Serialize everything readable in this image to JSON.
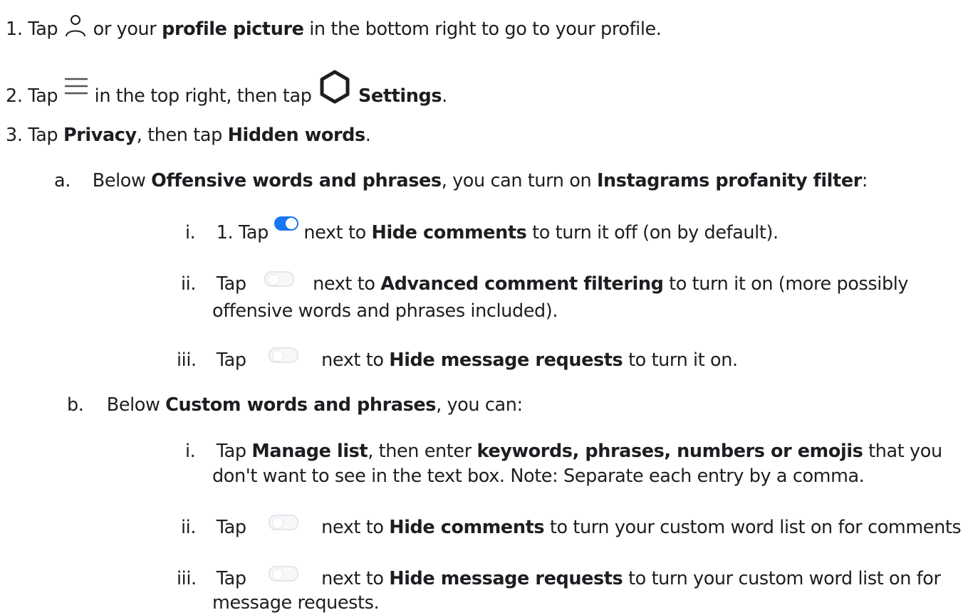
{
  "step1": {
    "prefix": "1. Tap",
    "mid": "or your",
    "bold": "profile picture",
    "suffix": "in the bottom right to go to your profile."
  },
  "step2": {
    "prefix": "2. Tap",
    "mid": "in the top right, then tap",
    "bold": "Settings",
    "suffix": "."
  },
  "step3": {
    "prefix": "3. Tap",
    "bold1": "Privacy",
    "mid": ", then tap",
    "bold2": "Hidden words",
    "suffix": "."
  },
  "a": {
    "marker": "a.",
    "prefix": "Below",
    "bold1": "Offensive words and phrases",
    "mid": ", you can turn on",
    "bold2": "Instagrams profanity filter",
    "suffix": ":",
    "items": [
      {
        "marker": "i.",
        "prefix": "1. Tap",
        "mid": "next to",
        "bold": "Hide comments",
        "suffix": "to turn it off (on by default)."
      },
      {
        "marker": "ii.",
        "prefix": "Tap",
        "mid": "next to",
        "bold": "Advanced comment filtering",
        "suffix": "to turn it on (more possibly",
        "line2": "offensive words and phrases included)."
      },
      {
        "marker": "iii.",
        "prefix": "Tap",
        "mid": "next to",
        "bold": "Hide message requests",
        "suffix": "to turn it on."
      }
    ]
  },
  "b": {
    "marker": "b.",
    "prefix": "Below",
    "bold": "Custom words and phrases",
    "suffix": ", you can:",
    "items": [
      {
        "marker": "i.",
        "prefix": "Tap",
        "bold1": "Manage list",
        "mid": ", then enter",
        "bold2": "keywords, phrases, numbers or emojis",
        "suffix": "that you",
        "line2": "don't want to see in the text box. Note: Separate each entry by a comma."
      },
      {
        "marker": "ii.",
        "prefix": "Tap",
        "mid": "next to",
        "bold": "Hide comments",
        "suffix": "to turn your custom word list on for comments."
      },
      {
        "marker": "iii.",
        "prefix": "Tap",
        "mid": "next to",
        "bold": "Hide message requests",
        "suffix": "to turn your custom word list on for",
        "line2": "message requests."
      }
    ]
  },
  "icons": {
    "profile": "profile-icon",
    "menu": "menu-icon",
    "settings": "settings-gear-icon",
    "toggle_on": "toggle-on-icon",
    "toggle_off": "toggle-off-icon"
  },
  "colors": {
    "text": "#1c1e21",
    "toggle_on": "#1877f2"
  }
}
